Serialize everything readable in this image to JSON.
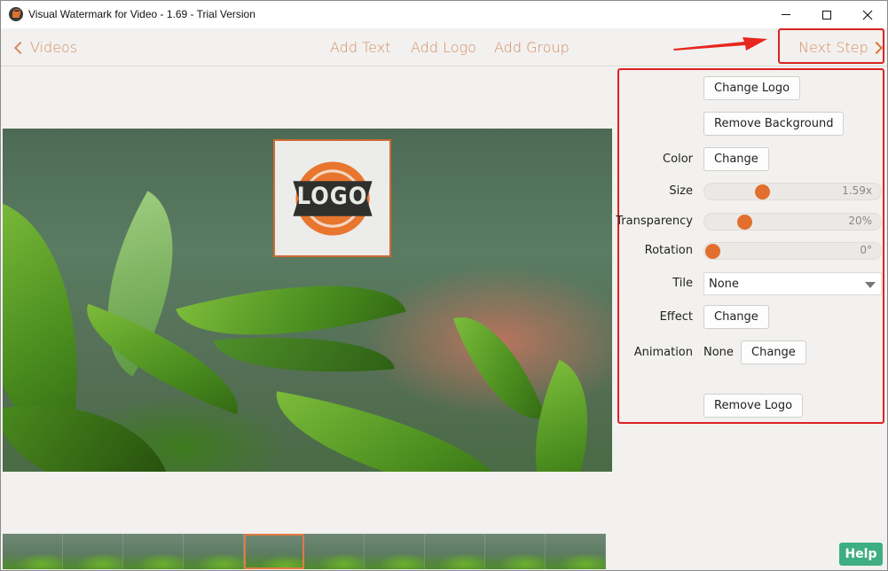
{
  "window": {
    "title": "Visual Watermark for Video - 1.69 - Trial Version",
    "controls": {
      "minimize": "minimize",
      "maximize": "maximize",
      "close": "✕"
    }
  },
  "toolbar": {
    "back_label": "Videos",
    "add_text": "Add Text",
    "add_logo": "Add Logo",
    "add_group": "Add Group",
    "next_step": "Next Step",
    "accent_color": "#d98a5e"
  },
  "preview": {
    "watermark_logo_text": "LOGO",
    "filmstrip_frames": 10,
    "selected_frame": 5
  },
  "panel": {
    "change_logo": "Change Logo",
    "remove_background": "Remove Background",
    "color_label": "Color",
    "color_button": "Change",
    "size_label": "Size",
    "size_value": "1.59x",
    "size_fraction": 0.31,
    "transparency_label": "Transparency",
    "transparency_value": "20%",
    "transparency_fraction": 0.2,
    "rotation_label": "Rotation",
    "rotation_value": "0°",
    "rotation_fraction": 0,
    "tile_label": "Tile",
    "tile_selected": "None",
    "effect_label": "Effect",
    "effect_button": "Change",
    "animation_label": "Animation",
    "animation_value": "None",
    "animation_button": "Change",
    "remove_logo": "Remove Logo"
  },
  "help": {
    "label": "Help",
    "color": "#3fae82"
  },
  "annotations": {
    "highlight_color": "#dd2222"
  }
}
